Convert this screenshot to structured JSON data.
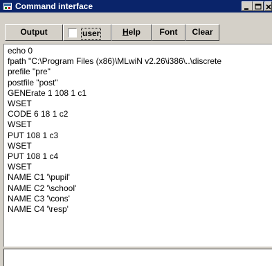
{
  "window": {
    "title": "Command interface",
    "controls": [
      "minimize",
      "maximize",
      "close"
    ]
  },
  "toolbar": {
    "output_label": "Output",
    "user_checkbox": {
      "label": "user",
      "checked": false
    },
    "help_label_first": "H",
    "help_label_rest": "elp",
    "font_label": "Font",
    "clear_label": "Clear"
  },
  "output": {
    "lines": [
      "echo 0",
      "fpath \"C:\\Program Files (x86)\\MLwiN v2.26\\i386\\..\\discrete",
      "prefile \"pre\"",
      "postfile \"post\"",
      "GENErate 1 108 1 c1",
      "WSET",
      "CODE 6 18 1 c2",
      "WSET",
      "PUT 108 1 c3",
      "WSET",
      "PUT 108 1 c4",
      "WSET",
      "NAME C1 '\\pupil'",
      "NAME C2 '\\school'",
      "NAME C3 '\\cons'",
      "NAME C4 '\\resp'"
    ]
  },
  "command_input": {
    "value": ""
  },
  "colors": {
    "titlebar": "#0a246a",
    "face": "#d4d0c8"
  }
}
